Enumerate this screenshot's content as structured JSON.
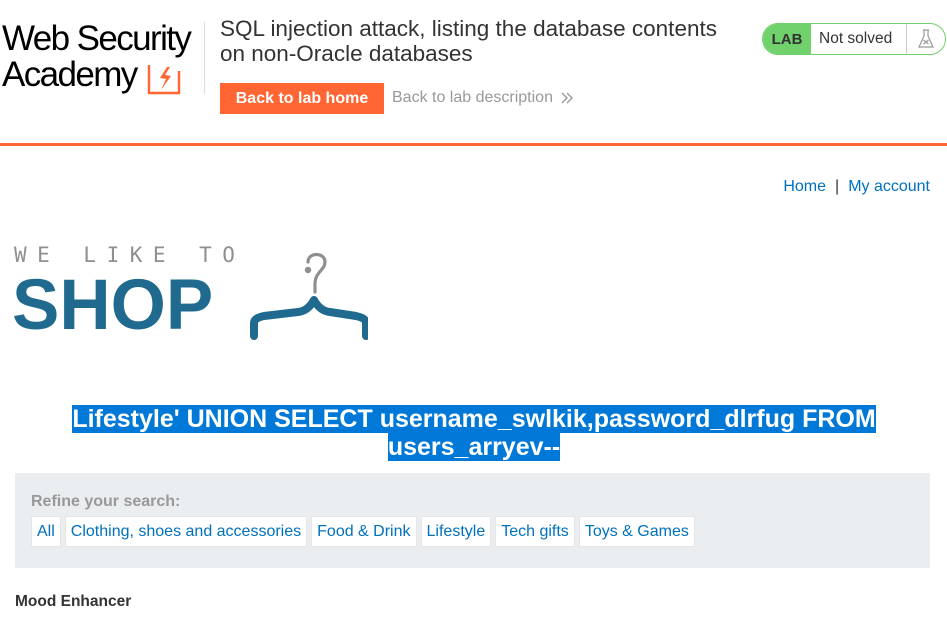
{
  "academy": {
    "logo_line1": "Web Security",
    "logo_line2": "Academy",
    "lab_title": "SQL injection attack, listing the database contents on non-Oracle databases",
    "back_home_label": "Back to lab home",
    "back_description_label": "Back to lab description",
    "lab_badge": "LAB",
    "lab_status": "Not solved"
  },
  "nav": {
    "home": "Home",
    "separator": "|",
    "my_account": "My account"
  },
  "shop_logo": {
    "tagline": "WE LIKE TO",
    "word": "SHOP"
  },
  "search": {
    "heading": "Lifestyle' UNION SELECT username_swlkik,password_dlrfug FROM users_arryev--"
  },
  "filters": {
    "title": "Refine your search:",
    "items": [
      {
        "label": "All"
      },
      {
        "label": "Clothing, shoes and accessories"
      },
      {
        "label": "Food & Drink"
      },
      {
        "label": "Lifestyle"
      },
      {
        "label": "Tech gifts"
      },
      {
        "label": "Toys & Games"
      }
    ]
  },
  "products": [
    {
      "name": "Mood Enhancer"
    }
  ],
  "colors": {
    "accent": "#ff6633",
    "status_green": "#70d16d",
    "link": "#0071bc",
    "shop_blue": "#1f6a8e",
    "selection": "#0078d7",
    "panel_bg": "#eaeef0"
  },
  "icons": {
    "lab_status": "flask-icon",
    "back_description": "double-chevron-right-icon",
    "shop_logo": "hanger-icon"
  }
}
